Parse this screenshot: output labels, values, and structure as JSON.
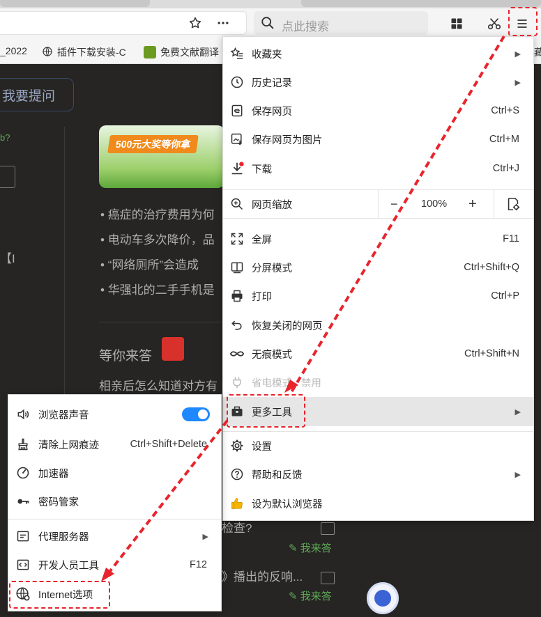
{
  "toolbar": {
    "search_placeholder": "点此搜索"
  },
  "bookmarks": [
    {
      "label": "_2022"
    },
    {
      "label": "插件下载安装-C"
    },
    {
      "label": "免费文献翻译"
    },
    {
      "label": "藏"
    }
  ],
  "page": {
    "ask_button": "我要提问",
    "side_text_1": "b?",
    "side_text_2": "【I",
    "banner_text": "500元大奖等你拿",
    "bullets": [
      "癌症的治疗费用为何",
      "电动车多次降价，品",
      "“网络厕所”会造成",
      "华强北的二手手机是"
    ],
    "section_title": "等你来答",
    "q1": "相亲后怎么知道对方有",
    "q2": "检查?",
    "q3": "》播出的反响...",
    "answer_link_1": "我来答",
    "answer_link_2": "我来答"
  },
  "main_menu": {
    "favorites": "收藏夹",
    "history": "历史记录",
    "save_page": "保存网页",
    "save_page_shortcut": "Ctrl+S",
    "save_as_image": "保存网页为图片",
    "save_as_image_shortcut": "Ctrl+M",
    "download": "下载",
    "download_shortcut": "Ctrl+J",
    "zoom": "网页缩放",
    "zoom_minus": "−",
    "zoom_value": "100%",
    "zoom_plus": "+",
    "fullscreen": "全屏",
    "fullscreen_shortcut": "F11",
    "split": "分屏模式",
    "split_shortcut": "Ctrl+Shift+Q",
    "print": "打印",
    "print_shortcut": "Ctrl+P",
    "restore": "恢复关闭的网页",
    "incognito": "无痕模式",
    "incognito_shortcut": "Ctrl+Shift+N",
    "power_save": "省电模式 · 禁用",
    "more_tools": "更多工具",
    "settings": "设置",
    "help": "帮助和反馈",
    "default_browser": "设为默认浏览器"
  },
  "sub_menu": {
    "sound": "浏览器声音",
    "sound_enabled": true,
    "clear_history": "清除上网痕迹",
    "clear_history_shortcut": "Ctrl+Shift+Delete",
    "accelerator": "加速器",
    "password": "密码管家",
    "proxy": "代理服务器",
    "devtools": "开发人员工具",
    "devtools_shortcut": "F12",
    "internet_options": "Internet选项"
  },
  "colors": {
    "annotation_red": "#e8242c",
    "toggle_blue": "#1e88ff",
    "highlight_gray": "#e6e6e6"
  }
}
